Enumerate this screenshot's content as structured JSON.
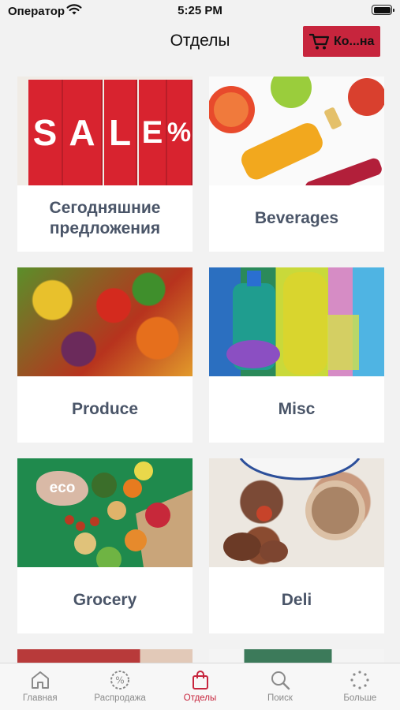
{
  "status": {
    "carrier": "Оператор",
    "time": "5:25 PM"
  },
  "header": {
    "title": "Отделы",
    "cart_label": "Ко...на"
  },
  "departments": [
    {
      "label": "Сегодняшние предложения",
      "image_text": "SALE%"
    },
    {
      "label": "Beverages"
    },
    {
      "label": "Produce"
    },
    {
      "label": "Misc"
    },
    {
      "label": "Grocery",
      "image_text": "eco"
    },
    {
      "label": "Deli"
    }
  ],
  "tabs": [
    {
      "label": "Главная",
      "icon": "home-icon"
    },
    {
      "label": "Распродажа",
      "icon": "sale-icon"
    },
    {
      "label": "Отделы",
      "icon": "shopping-bag-icon",
      "active": true
    },
    {
      "label": "Поиск",
      "icon": "search-icon"
    },
    {
      "label": "Больше",
      "icon": "more-icon"
    }
  ],
  "colors": {
    "accent": "#c7253d",
    "tile_text": "#4a5568",
    "tab_inactive": "#8a8a8a"
  }
}
